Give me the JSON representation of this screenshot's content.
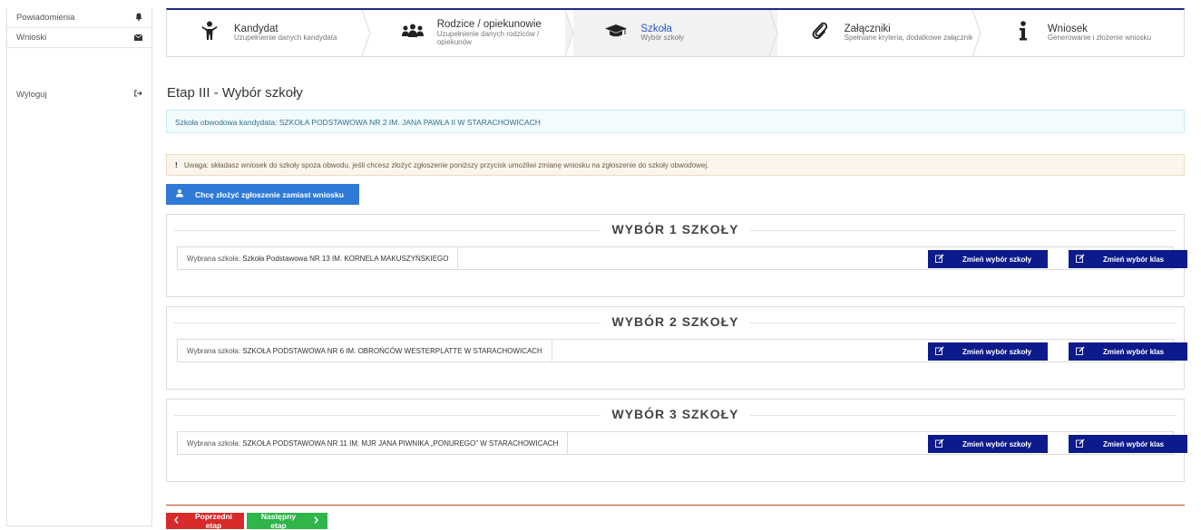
{
  "sidebar": {
    "items": [
      {
        "label": "Powiadomienia",
        "icon": "bell-icon",
        "glyph": "🔔"
      },
      {
        "label": "Wnioski",
        "icon": "envelope-icon",
        "glyph": "✉"
      }
    ],
    "logout": {
      "label": "Wyloguj",
      "icon": "sign-out-icon",
      "glyph": "⇥"
    }
  },
  "steps": [
    {
      "title": "Kandydat",
      "subtitle": "Uzupełnienie danych kandydata",
      "icon": "child-icon",
      "active": false
    },
    {
      "title": "Rodzice / opiekunowie",
      "subtitle": "Uzupełnienie danych rodziców / opiekunów",
      "icon": "group-icon",
      "active": false
    },
    {
      "title": "Szkoła",
      "subtitle": "Wybór szkoły",
      "icon": "graduation-cap-icon",
      "active": true
    },
    {
      "title": "Załączniki",
      "subtitle": "Spełniane kryteria, dodatkowe załączniki",
      "icon": "paperclip-icon",
      "active": false
    },
    {
      "title": "Wniosek",
      "subtitle": "Generowanie i złożenie wniosku",
      "icon": "info-icon",
      "active": false
    }
  ],
  "page_title": "Etap III - Wybór szkoły",
  "info": {
    "label": "Szkoła obwodowa kandydata:",
    "value": "SZKOŁA PODSTAWOWA NR 2 IM. JANA PAWŁA II W STARACHOWICACH"
  },
  "warning": {
    "mark": "!",
    "text": "Uwaga: składasz wniosek do szkoły spoza obwodu, jeśli chcesz złożyć zgłoszenie poniższy przycisk umożliwi zmianę wniosku na zgłoszenie do szkoły obwodowej."
  },
  "switch_button": {
    "label": "Chcę złożyć zgłoszenie zamiast wniosku",
    "icon": "user-upload-icon"
  },
  "choices": [
    {
      "heading": "WYBÓR 1 SZKOŁY",
      "label": "Wybrana szkoła:",
      "school": "Szkoła Podstawowa NR 13 IM. KORNELA MAKUSZYŃSKIEGO",
      "change_school": "Zmień wybór szkoły",
      "change_class": "Zmień wybór klas"
    },
    {
      "heading": "WYBÓR 2 SZKOŁY",
      "label": "Wybrana szkoła:",
      "school": "SZKOŁA PODSTAWOWA NR 6 IM. OBROŃCÓW WESTERPLATTE W STARACHOWICACH",
      "change_school": "Zmień wybór szkoły",
      "change_class": "Zmień wybór klas"
    },
    {
      "heading": "WYBÓR 3 SZKOŁY",
      "label": "Wybrana szkoła:",
      "school": "SZKOŁA PODSTAWOWA NR 11 IM. MJR JANA PIWNIKA „PONUREGO\" W STARACHOWICACH",
      "change_school": "Zmień wybór szkoły",
      "change_class": "Zmień wybór klas"
    }
  ],
  "footer": {
    "prev": "Poprzedni etap",
    "next": "Następny etap"
  },
  "colors": {
    "primary_dark": "#0d1a8c",
    "primary": "#2f7ad6",
    "danger": "#d72a2a",
    "success": "#2fb54a"
  }
}
